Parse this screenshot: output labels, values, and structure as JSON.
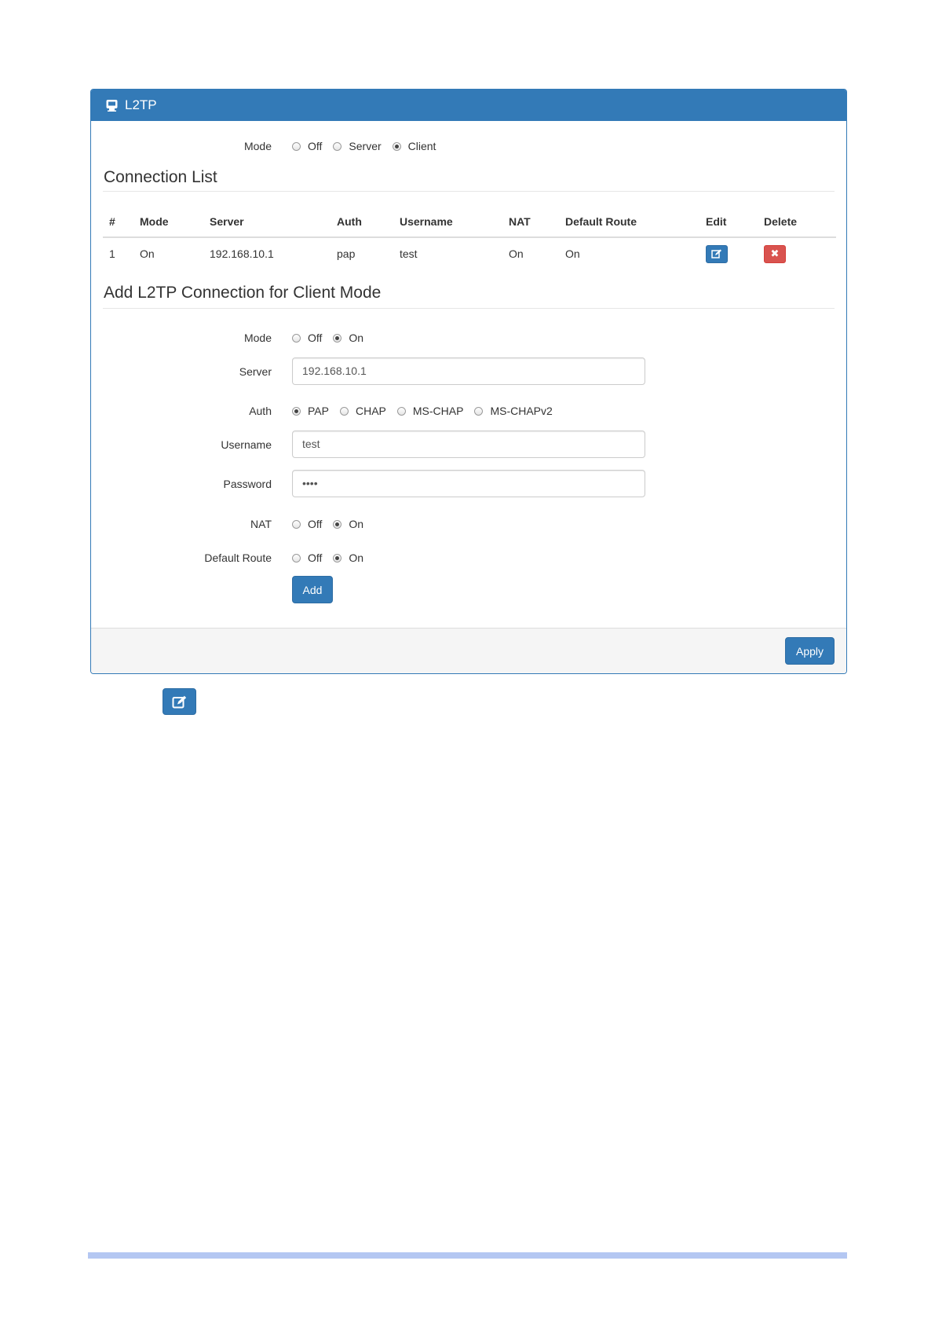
{
  "panel": {
    "title": "L2TP"
  },
  "mode_row": {
    "label": "Mode",
    "options": [
      {
        "label": "Off",
        "checked": false
      },
      {
        "label": "Server",
        "checked": false
      },
      {
        "label": "Client",
        "checked": true
      }
    ]
  },
  "connection_list": {
    "heading": "Connection List",
    "columns": [
      "#",
      "Mode",
      "Server",
      "Auth",
      "Username",
      "NAT",
      "Default Route",
      "Edit",
      "Delete"
    ],
    "rows": [
      {
        "num": "1",
        "mode": "On",
        "server": "192.168.10.1",
        "auth": "pap",
        "username": "test",
        "nat": "On",
        "default_route": "On"
      }
    ],
    "delete_glyph": "✖"
  },
  "add_form": {
    "heading": "Add L2TP Connection for Client Mode",
    "mode": {
      "label": "Mode",
      "options": [
        {
          "label": "Off",
          "checked": false
        },
        {
          "label": "On",
          "checked": true
        }
      ]
    },
    "server": {
      "label": "Server",
      "value": "192.168.10.1"
    },
    "auth": {
      "label": "Auth",
      "options": [
        {
          "label": "PAP",
          "checked": true
        },
        {
          "label": "CHAP",
          "checked": false
        },
        {
          "label": "MS-CHAP",
          "checked": false
        },
        {
          "label": "MS-CHAPv2",
          "checked": false
        }
      ]
    },
    "username": {
      "label": "Username",
      "value": "test"
    },
    "password": {
      "label": "Password",
      "value": "••••"
    },
    "nat": {
      "label": "NAT",
      "options": [
        {
          "label": "Off",
          "checked": false
        },
        {
          "label": "On",
          "checked": true
        }
      ]
    },
    "default_route": {
      "label": "Default Route",
      "options": [
        {
          "label": "Off",
          "checked": false
        },
        {
          "label": "On",
          "checked": true
        }
      ]
    },
    "add_label": "Add"
  },
  "footer": {
    "apply_label": "Apply"
  },
  "colors": {
    "primary": "#337ab7",
    "danger": "#d9534f",
    "footer_bg": "#f5f5f5",
    "bottom_bar": "#b4c7f2"
  },
  "icons": {
    "header": "monitor-icon",
    "edit": "edit-icon",
    "delete": "close-icon"
  }
}
